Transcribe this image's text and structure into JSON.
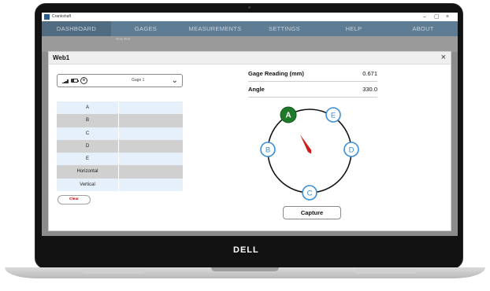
{
  "window": {
    "title": "Crankshaft",
    "controls": [
      "–",
      "▢",
      "×"
    ]
  },
  "menu": [
    "DASHBOARD",
    "GAGES",
    "MEASUREMENTS",
    "SETTINGS",
    "HELP",
    "ABOUT"
  ],
  "background_text": "Row Text",
  "dialog": {
    "title": "Web1",
    "close": "×",
    "gage": {
      "selected": "Gage 1"
    },
    "rows": [
      {
        "label": "A",
        "value": ""
      },
      {
        "label": "B",
        "value": ""
      },
      {
        "label": "C",
        "value": ""
      },
      {
        "label": "D",
        "value": ""
      },
      {
        "label": "E",
        "value": ""
      },
      {
        "label": "Horizontal",
        "value": ""
      },
      {
        "label": "Vertical",
        "value": ""
      }
    ],
    "clear_label": "Clear",
    "gage_reading": {
      "label": "Gage Reading (mm)",
      "value": "0.671"
    },
    "angle": {
      "label": "Angle",
      "value": "330.0"
    },
    "dial_points": [
      {
        "label": "A",
        "active": true
      },
      {
        "label": "B",
        "active": false
      },
      {
        "label": "C",
        "active": false
      },
      {
        "label": "D",
        "active": false
      },
      {
        "label": "E",
        "active": false
      }
    ],
    "capture_label": "Capture"
  },
  "brand": "DELL",
  "colors": {
    "menu_bar": "#5f7c95",
    "active_point": "#1e7a2a",
    "point_ring": "#3a8fd8",
    "needle": "#cc1d1d",
    "clear_text": "#c00000"
  },
  "icons": [
    "signal-icon",
    "battery-icon",
    "globe-icon",
    "chevron-down-icon",
    "close-icon"
  ]
}
